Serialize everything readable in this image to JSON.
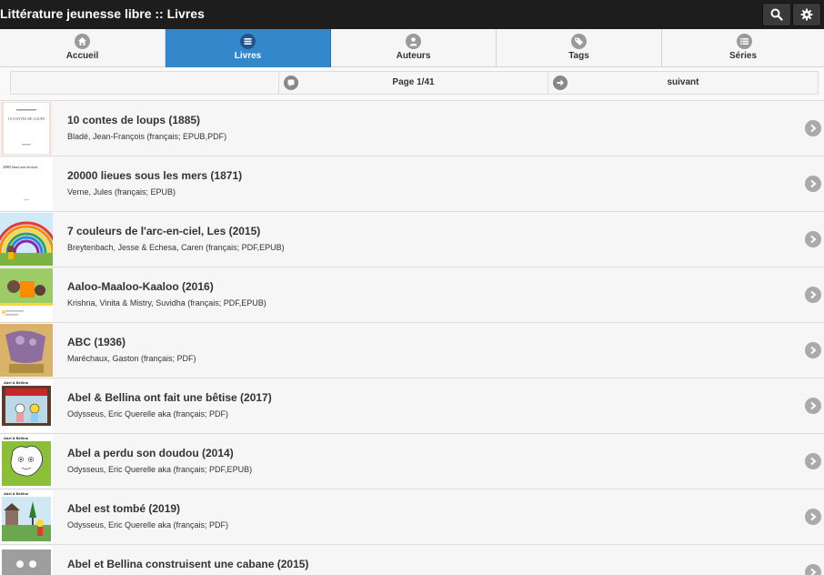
{
  "header": {
    "title": "Littérature jeunesse libre :: Livres",
    "search_icon": "search-icon",
    "settings_icon": "gear-icon"
  },
  "nav": {
    "tabs": [
      {
        "label": "Accueil",
        "icon": "home-icon",
        "active": false
      },
      {
        "label": "Livres",
        "icon": "list-icon",
        "active": true
      },
      {
        "label": "Auteurs",
        "icon": "user-icon",
        "active": false
      },
      {
        "label": "Tags",
        "icon": "tag-icon",
        "active": false
      },
      {
        "label": "Séries",
        "icon": "series-list-icon",
        "active": false
      }
    ]
  },
  "pager": {
    "page_label": "Page 1/41",
    "next_label": "suivant"
  },
  "books": [
    {
      "title": "10 contes de loups (1885)",
      "meta": "Bladé, Jean-François (français; EPUB,PDF)"
    },
    {
      "title": "20000 lieues sous les mers (1871)",
      "meta": "Verne, Jules (français; EPUB)"
    },
    {
      "title": "7 couleurs de l'arc-en-ciel, Les (2015)",
      "meta": "Breytenbach, Jesse & Echesa, Caren (français; PDF,EPUB)"
    },
    {
      "title": "Aaloo-Maaloo-Kaaloo (2016)",
      "meta": "Krishna, Vinita & Mistry, Suvidha (français; PDF,EPUB)"
    },
    {
      "title": "ABC (1936)",
      "meta": "Maréchaux, Gaston (français; PDF)"
    },
    {
      "title": "Abel & Bellina ont fait une bêtise (2017)",
      "meta": "Odysseus, Eric Querelle aka (français; PDF)"
    },
    {
      "title": "Abel a perdu son doudou (2014)",
      "meta": "Odysseus, Eric Querelle aka (français; PDF,EPUB)"
    },
    {
      "title": "Abel est tombé (2019)",
      "meta": "Odysseus, Eric Querelle aka (français; PDF)"
    },
    {
      "title": "Abel et Bellina construisent une cabane (2015)",
      "meta": ""
    }
  ],
  "cover_text": {
    "book1": "10 CONTES DE LOUPS",
    "book2": "20000 lieues sous les mers",
    "abel": "Abel & Bellina"
  },
  "colors": {
    "accent": "#3388cc",
    "header_bg": "#1d1d1d"
  }
}
